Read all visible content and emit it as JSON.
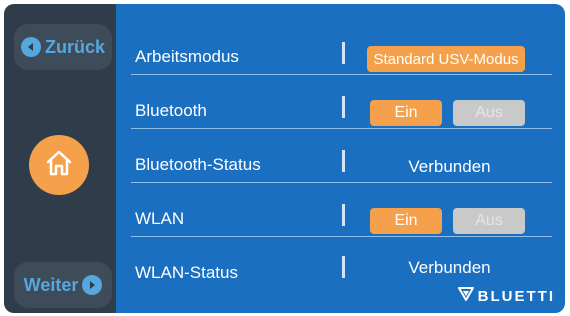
{
  "sidebar": {
    "back_label": "Zurück",
    "next_label": "Weiter"
  },
  "rows": [
    {
      "label": "Arbeitsmodus",
      "value": "Standard USV-Modus"
    },
    {
      "label": "Bluetooth",
      "on": "Ein",
      "off": "Aus"
    },
    {
      "label": "Bluetooth-Status",
      "value": "Verbunden"
    },
    {
      "label": "WLAN",
      "on": "Ein",
      "off": "Aus"
    },
    {
      "label": "WLAN-Status",
      "value": "Verbunden"
    }
  ],
  "brand": "BLUETTI",
  "colors": {
    "accent": "#f5a04a",
    "panel": "#1a6fc0",
    "sidebar": "#2f3d4b",
    "sidebar_text": "#55a7de",
    "disabled": "#c9c9c9"
  }
}
